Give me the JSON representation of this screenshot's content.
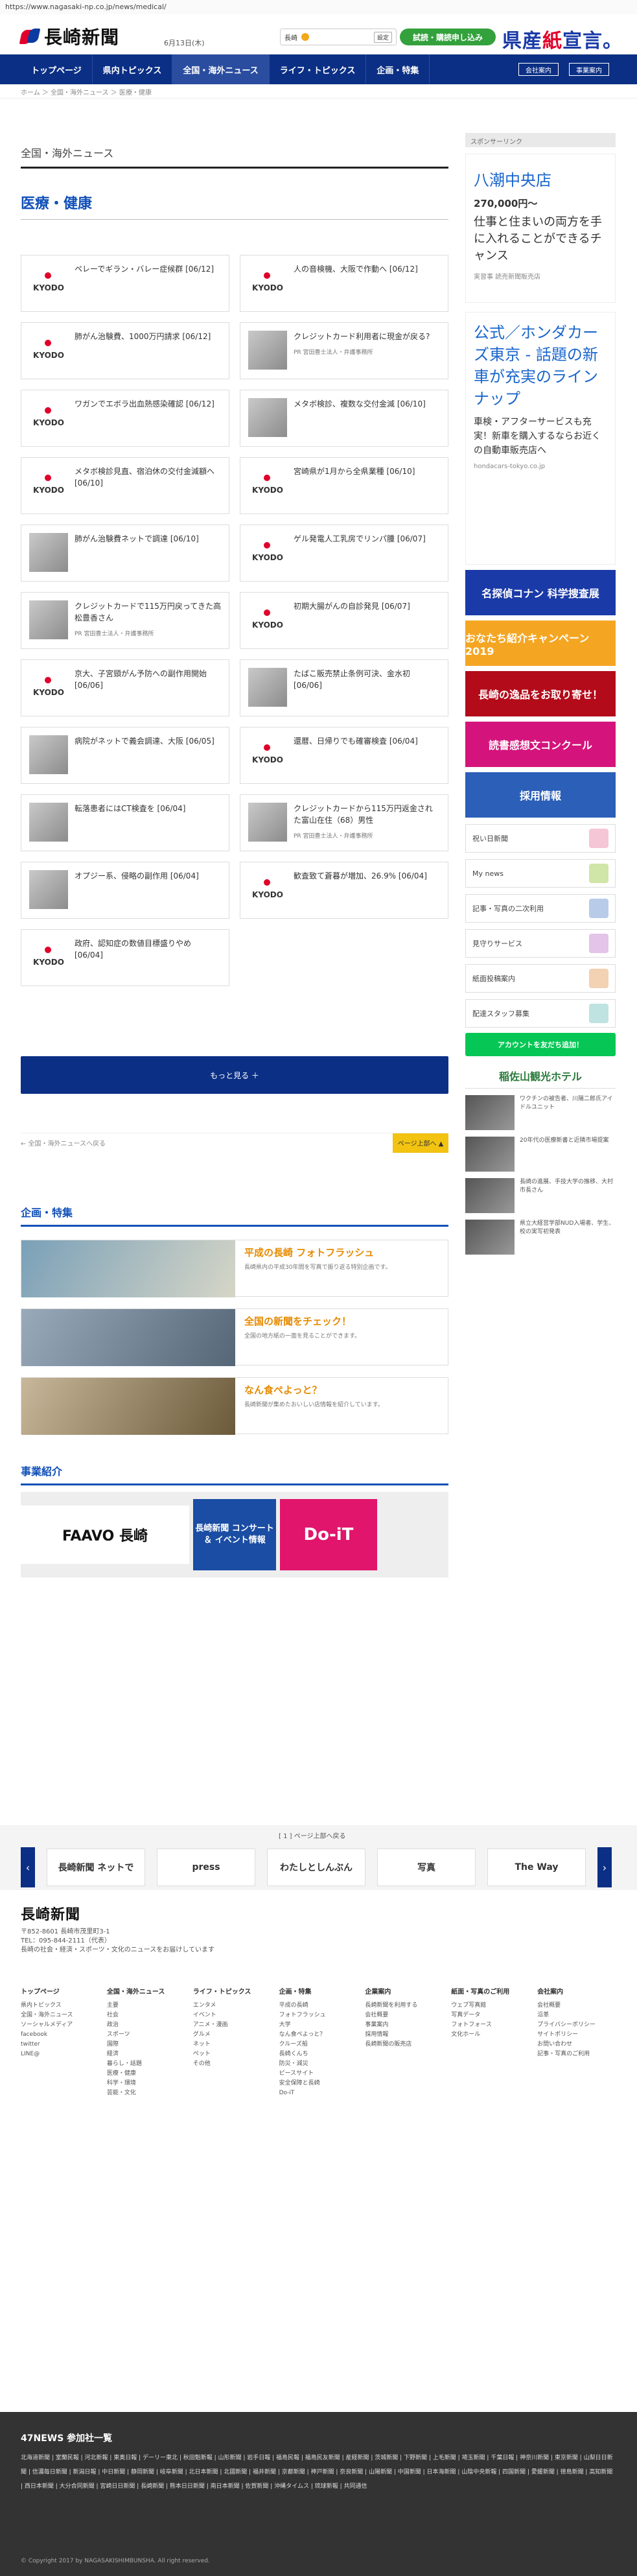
{
  "url": "https://www.nagasaki-np.co.jp/news/medical/",
  "header": {
    "logo": "長崎新聞",
    "date": "6月13日(木)",
    "weather": "長崎",
    "weather_btn": "設定",
    "trial": "試読・購読申し込み",
    "brand_left": "県産",
    "brand_mid": "紙",
    "brand_right": "宣言。"
  },
  "nav": {
    "items": [
      "トップページ",
      "県内トピックス",
      "全国・海外ニュース",
      "ライフ・トピックス",
      "企画・特集"
    ],
    "right1": "会社案内",
    "right2": "事業案内"
  },
  "crumb": "ホーム ＞ 全国・海外ニュース ＞ 医療・健康",
  "main": {
    "section": "全国・海外ニュース",
    "category": "医療・健康",
    "more": "もっと見る ＋",
    "back": "← 全国・海外ニュースへ戻る",
    "top": "ページ上部へ ▲",
    "articles": [
      {
        "t": "ペレーでギラン・バレー症候群 [06/12]",
        "logo": "KYODO"
      },
      {
        "t": "人の音検機、大阪で作動へ [06/12]",
        "logo": "KYODO"
      },
      {
        "t": "肺がん治験費、1000万円請求 [06/12]",
        "logo": "KYODO"
      },
      {
        "t": "クレジットカード利用者に現金が戻る?",
        "pr": "PR 宮田豊士法人・弁護事務所"
      },
      {
        "t": "ワガンでエボラ出血熱感染確認 [06/12]",
        "logo": "KYODO"
      },
      {
        "t": "メタボ検診、複数な交付金減 [06/10]",
        "pr": ""
      },
      {
        "t": "メタボ検診見直、宿泊休の交付金減額へ [06/10]",
        "logo": "KYODO"
      },
      {
        "t": "宮崎県が1月から全県業種 [06/10]",
        "logo": "KYODO"
      },
      {
        "t": "肺がん治験費ネットで調達 [06/10]",
        "pr": ""
      },
      {
        "t": "ゲル発電人工乳房でリンパ腫 [06/07]",
        "logo": "KYODO"
      },
      {
        "t": "クレジットカードで115万円戻ってきた高松豊香さん",
        "pr": "PR 宮田豊士法人・弁護事務所"
      },
      {
        "t": "初期大腸がんの自診発見 [06/07]",
        "logo": "KYODO"
      },
      {
        "t": "京大、子宮頸がん予防への副作用開始 [06/06]",
        "logo": "KYODO"
      },
      {
        "t": "たばこ販売禁止条例可決、金水初 [06/06]",
        "pr": ""
      },
      {
        "t": "病院がネットで義会調達、大阪 [06/05]",
        "pr": ""
      },
      {
        "t": "還暦、日帰りでも確審検査 [06/04]",
        "logo": "KYODO"
      },
      {
        "t": "転落患者にはCT検査を [06/04]",
        "pr": ""
      },
      {
        "t": "クレジットカードから115万円返金された富山在住（68）男性",
        "pr": "PR 宮田豊士法人・弁護事務所"
      },
      {
        "t": "オプジー系、侵略の副作用 [06/04]",
        "pr": ""
      },
      {
        "t": "歓査致て蒼暮が増加、26.9% [06/04]",
        "logo": "KYODO"
      },
      {
        "t": "政府、認知症の数値目標盛りやめ [06/04]",
        "logo": "KYODO"
      }
    ]
  },
  "features": {
    "title": "企画・特集",
    "items": [
      {
        "t": "平成の長崎 フォトフラッシュ",
        "d": "長崎県内の平成30年間を写真で振り返る特別企画です。"
      },
      {
        "t": "全国の新聞をチェック！",
        "d": "全国の地方紙の一面を見ることができます。"
      },
      {
        "t": "なん食ぺよっと？",
        "d": "長崎新聞が集めたおいしい店情報を紹介しています。"
      }
    ]
  },
  "business": {
    "title": "事業紹介",
    "b1": "FAAVO 長崎",
    "b2": "長崎新聞 コンサート ＆ イベント情報",
    "b3": "Do-iT"
  },
  "side": {
    "sponsor": "スポンサーリンク",
    "ad1": {
      "h": "八潮中央店",
      "p": "270,000円～",
      "d": "仕事と住まいの両方を手に入れることができるチャンス",
      "s": "実習事 読売新聞販売店"
    },
    "ad2": {
      "h": "公式／ホンダカーズ東京 - 話題の新車が充実のラインナップ",
      "d": "車検・アフターサービスも充実！新車を購入するならお近くの自動車販売店へ",
      "s": "hondacars-tokyo.co.jp"
    },
    "links": [
      "祝い日新聞",
      "My news",
      "記事・写真の二次利用",
      "見守りサービス",
      "紙面投稿案内",
      "配達スタッフ募集"
    ],
    "banners": [
      "名探偵コナン 科学捜査展",
      "おなたち紹介キャンペーン2019",
      "長崎の逸品をお取り寄せ！",
      "読書感想文コンクール",
      "採用情報"
    ],
    "line": "アカウントを友だち追加！",
    "hotel": "稲佐山観光ホテル",
    "minis": [
      "ワクチンの被告者、川陽二郎氏アイドルユニット",
      "20年代の医療新書と近隣市場提案",
      "長崎の進展、手技大学の推移、大村市長さん",
      "県立大経営学部NUD入場者、学生、校の実写初発表"
    ]
  },
  "strip": {
    "pg": "[ 1 ] ページ上部へ戻る",
    "items": [
      "長崎新聞 ネットで",
      "press",
      "わたしとしんぶん",
      "写真",
      "The Way"
    ]
  },
  "footer": {
    "addr1": "〒852-8601 長崎市茂里町3-1",
    "addr2": "TEL：095-844-2111（代表）",
    "note": "長崎の社会・経済・スポーツ・文化のニュースをお届けしています",
    "cols": [
      {
        "h": "トップページ",
        "l": [
          "県内トピックス",
          "全国・海外ニュース",
          "ソーシャルメディア",
          "facebook",
          "twitter",
          "LINE@"
        ]
      },
      {
        "h": "全国・海外ニュース",
        "l": [
          "主要",
          "社会",
          "政治",
          "スポーツ",
          "国際",
          "経済",
          "暮らし・話題",
          "医療・健康",
          "科学・環境",
          "芸能・文化"
        ]
      },
      {
        "h": "ライフ・トピックス",
        "l": [
          "エンタメ",
          "イベント",
          "アニメ・漫画",
          "グルメ",
          "ネット",
          "ペット",
          "その他"
        ]
      },
      {
        "h": "企画・特集",
        "l": [
          "平成の長崎",
          "フォトフラッシュ",
          "大学",
          "なん食ぺよっと？",
          "クルーズ船",
          "長崎くんち",
          "防災・減災",
          "ピースサイト",
          "安全保障と長崎",
          "Do-iT"
        ]
      },
      {
        "h": "企業案内",
        "l": [
          "長崎新聞を利用する",
          "会社概要",
          "事業案内",
          "採用情報",
          "長崎新聞の販売店"
        ]
      },
      {
        "h": "紙面・写真のご利用",
        "l": [
          "ウェブ写真館",
          "写真データ",
          "フォトフォース",
          "文化ホール"
        ]
      },
      {
        "h": "会社案内",
        "l": [
          "会社概要",
          "沿革",
          "プライバシーポリシー",
          "サイトポリシー",
          "お問い合わせ",
          "記事・写真のご利用"
        ]
      }
    ]
  },
  "dark": {
    "h": "47NEWS 参加社一覧",
    "links": "北海道新聞 | 室蘭民報 | 河北新報 | 東奥日報 | デーリー東北 | 秋田魁新報 | 山形新聞 | 岩手日報 | 福島民報 | 福島民友新聞 | 産経新聞 | 茨城新聞 | 下野新聞 | 上毛新聞 | 埼玉新聞 | 千葉日報 | 神奈川新聞 | 東京新聞 | 山梨日日新聞 | 信濃毎日新聞 | 新潟日報 | 中日新聞 | 静岡新聞 | 岐阜新聞 | 北日本新聞 | 北國新聞 | 福井新聞 | 京都新聞 | 神戸新聞 | 奈良新聞 | 山陽新聞 | 中国新聞 | 日本海新聞 | 山陰中央新報 | 四国新聞 | 愛媛新聞 | 徳島新聞 | 高知新聞 | 西日本新聞 | 大分合同新聞 | 宮崎日日新聞 | 長崎新聞 | 熊本日日新聞 | 南日本新聞 | 佐賀新聞 | 沖縄タイムス | 琉球新報 | 共同通信",
    "copy": "© Copyright 2017 by NAGASAKISHIMBUNSHA. All right reserved."
  }
}
